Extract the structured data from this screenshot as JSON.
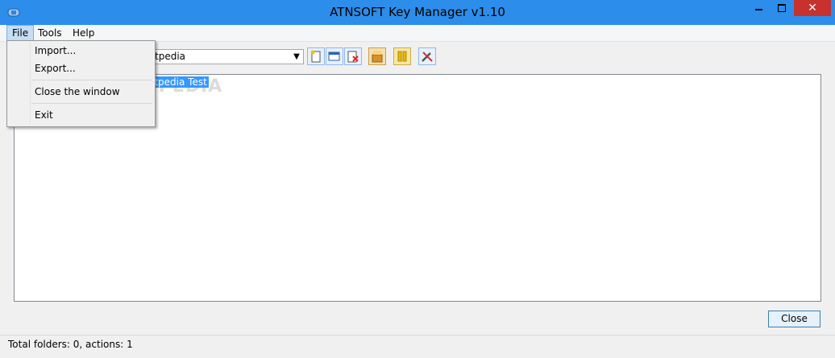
{
  "window": {
    "title": "ATNSOFT Key Manager v1.10",
    "close_glyph": "✕"
  },
  "menubar": {
    "items": [
      "File",
      "Tools",
      "Help"
    ]
  },
  "file_menu": {
    "import": "Import...",
    "export": "Export...",
    "close_window": "Close the window",
    "exit": "Exit"
  },
  "toolbar": {
    "combo_value": "ftpedia"
  },
  "tree": {
    "selected_item": "oftpedia Test",
    "watermark": "SOFTPEDIA"
  },
  "buttons": {
    "close": "Close"
  },
  "status": {
    "text": "Total folders: 0, actions: 1"
  },
  "colors": {
    "titlebar": "#2d8dea",
    "close_button": "#c7312e",
    "selection": "#3399ff"
  }
}
